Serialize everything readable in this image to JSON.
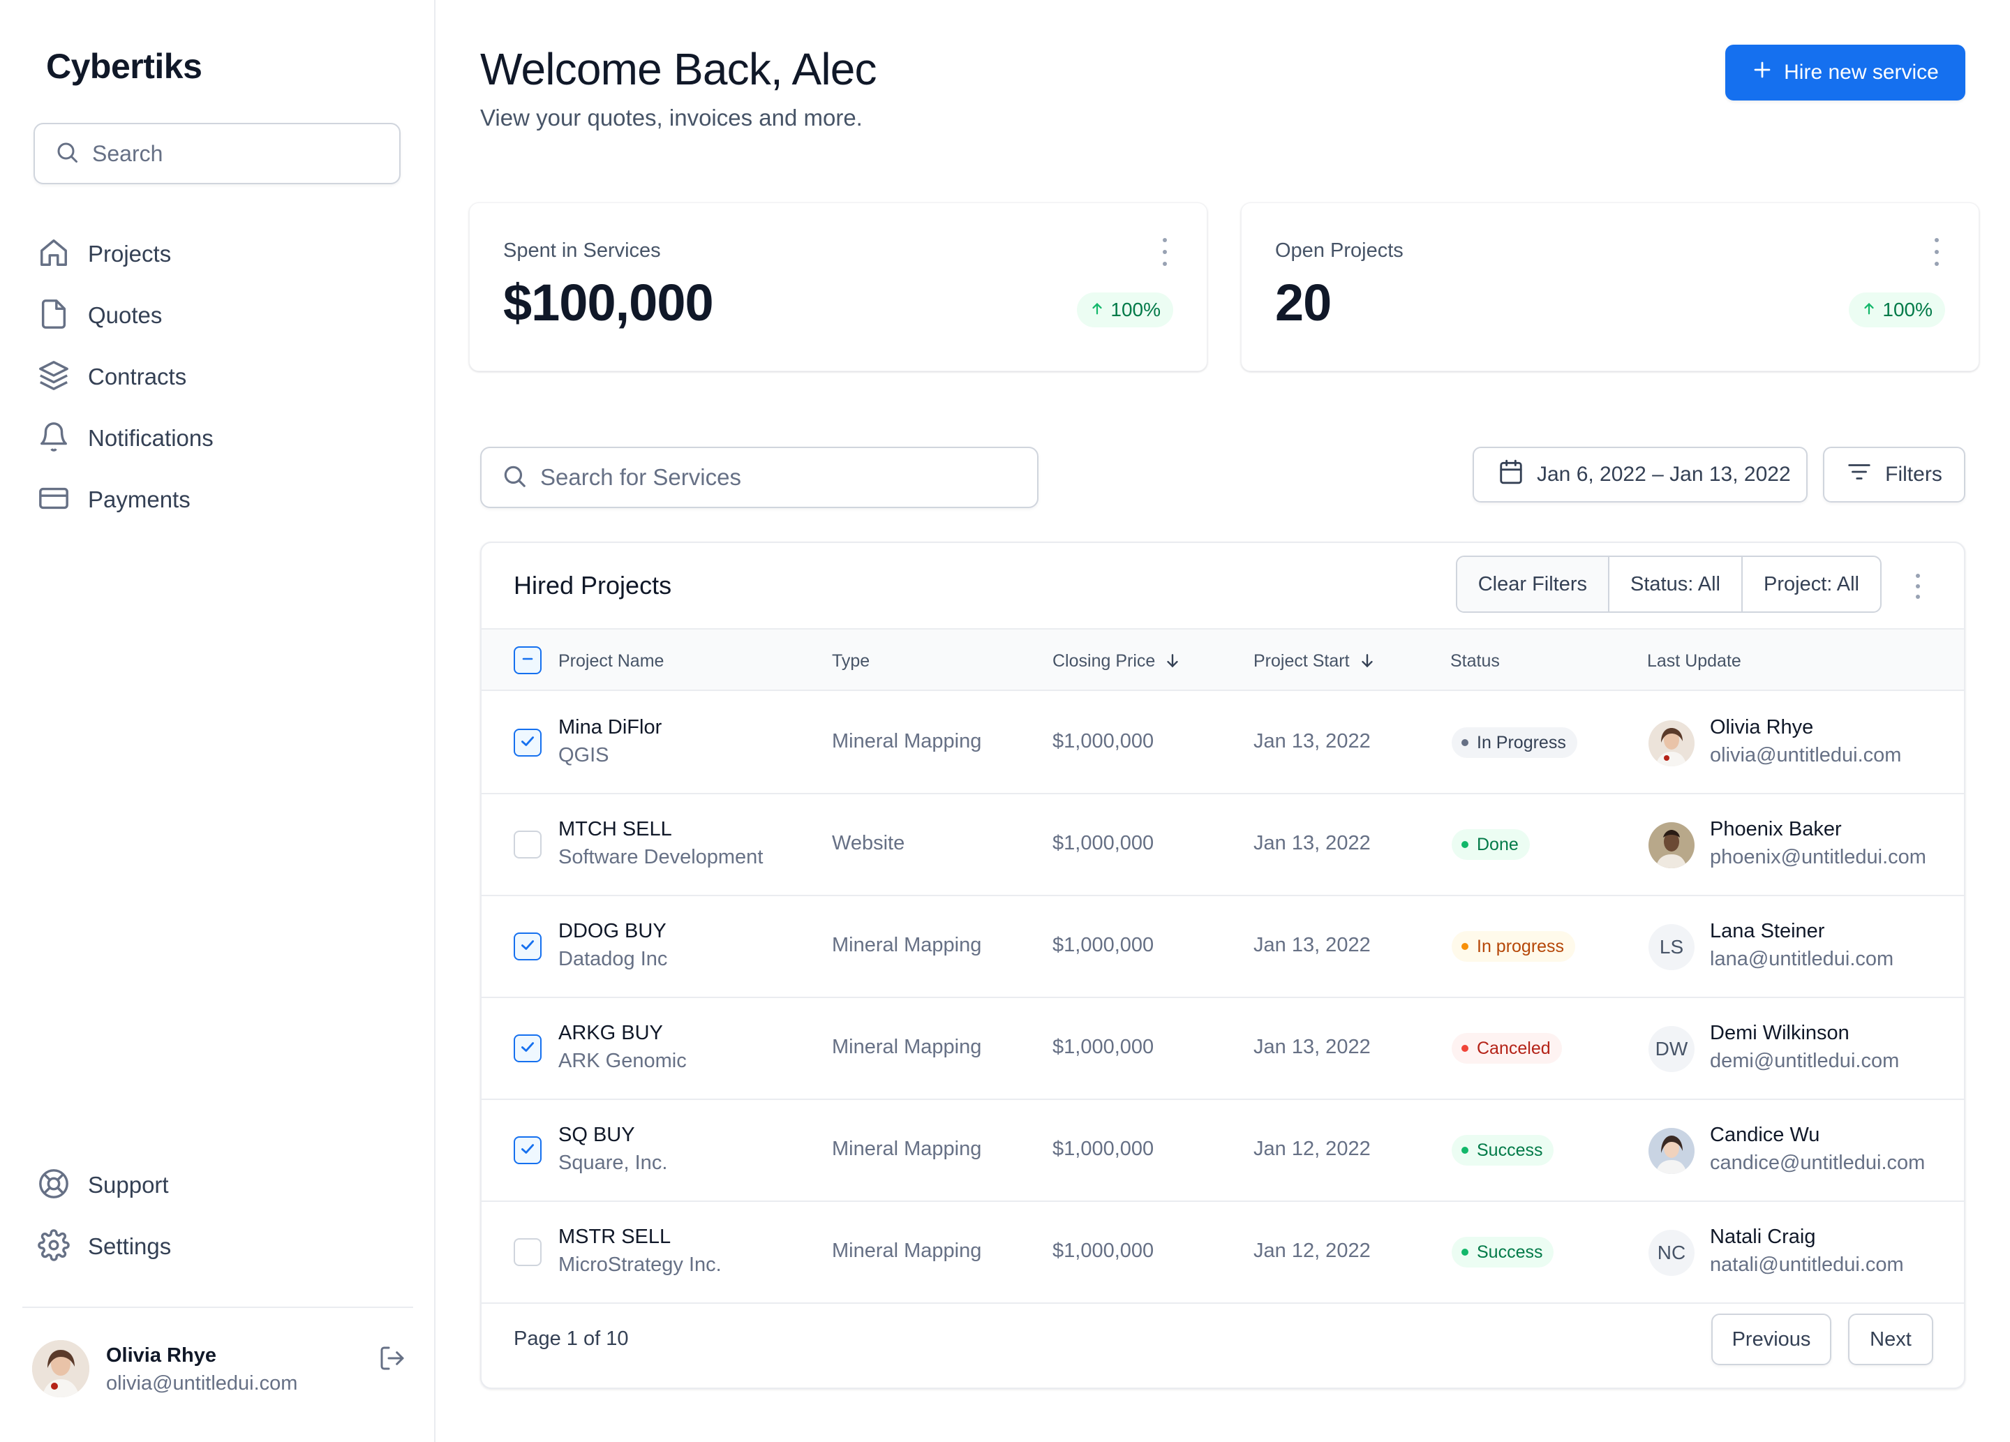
{
  "sidebar": {
    "brand": "Cybertiks",
    "search_placeholder": "Search",
    "nav": [
      {
        "label": "Projects",
        "icon": "home-icon"
      },
      {
        "label": "Quotes",
        "icon": "file-icon"
      },
      {
        "label": "Contracts",
        "icon": "layers-icon"
      },
      {
        "label": "Notifications",
        "icon": "bell-icon"
      },
      {
        "label": "Payments",
        "icon": "credit-card-icon"
      }
    ],
    "bottom_nav": [
      {
        "label": "Support",
        "icon": "life-buoy-icon"
      },
      {
        "label": "Settings",
        "icon": "gear-icon"
      }
    ],
    "user": {
      "name": "Olivia Rhye",
      "email": "olivia@untitledui.com"
    }
  },
  "header": {
    "title": "Welcome Back, Alec",
    "subtitle": "View your quotes, invoices and more.",
    "hire_button": "Hire new service"
  },
  "stats": [
    {
      "label": "Spent in Services",
      "value": "$100,000",
      "change": "100%"
    },
    {
      "label": "Open Projects",
      "value": "20",
      "change": "100%"
    }
  ],
  "toolbar": {
    "search_placeholder": "Search for Services",
    "date_range": "Jan 6, 2022 – Jan 13, 2022",
    "filters_label": "Filters"
  },
  "table": {
    "title": "Hired Projects",
    "segments": [
      "Clear Filters",
      "Status: All",
      "Project: All"
    ],
    "columns": [
      "Project Name",
      "Type",
      "Closing Price",
      "Project Start",
      "Status",
      "Last Update"
    ],
    "rows": [
      {
        "checked": true,
        "name": "Mina DiFlor",
        "company": "QGIS",
        "type": "Mineral Mapping",
        "price": "$1,000,000",
        "start": "Jan 13, 2022",
        "status": "In Progress",
        "status_kind": "gray",
        "user": "Olivia Rhye",
        "email": "olivia@untitledui.com",
        "initials": ""
      },
      {
        "checked": false,
        "name": "MTCH SELL",
        "company": "Software Development",
        "type": "Website",
        "price": "$1,000,000",
        "start": "Jan 13, 2022",
        "status": "Done",
        "status_kind": "green",
        "user": "Phoenix Baker",
        "email": "phoenix@untitledui.com",
        "initials": ""
      },
      {
        "checked": true,
        "name": "DDOG BUY",
        "company": "Datadog Inc",
        "type": "Mineral Mapping",
        "price": "$1,000,000",
        "start": "Jan 13, 2022",
        "status": "In progress",
        "status_kind": "amber",
        "user": "Lana Steiner",
        "email": "lana@untitledui.com",
        "initials": "LS"
      },
      {
        "checked": true,
        "name": "ARKG BUY",
        "company": "ARK Genomic",
        "type": "Mineral Mapping",
        "price": "$1,000,000",
        "start": "Jan 13, 2022",
        "status": "Canceled",
        "status_kind": "red",
        "user": "Demi Wilkinson",
        "email": "demi@untitledui.com",
        "initials": "DW"
      },
      {
        "checked": true,
        "name": "SQ BUY",
        "company": "Square, Inc.",
        "type": "Mineral Mapping",
        "price": "$1,000,000",
        "start": "Jan 12, 2022",
        "status": "Success",
        "status_kind": "green",
        "user": "Candice Wu",
        "email": "candice@untitledui.com",
        "initials": ""
      },
      {
        "checked": false,
        "name": "MSTR SELL",
        "company": "MicroStrategy Inc.",
        "type": "Mineral Mapping",
        "price": "$1,000,000",
        "start": "Jan 12, 2022",
        "status": "Success",
        "status_kind": "green",
        "user": "Natali Craig",
        "email": "natali@untitledui.com",
        "initials": "NC"
      }
    ],
    "pagination": {
      "info": "Page 1 of 10",
      "previous": "Previous",
      "next": "Next"
    }
  },
  "colors": {
    "accent": "#1570ef",
    "success_bg": "#ecfdf3",
    "success_text": "#027a48",
    "warning_bg": "#fffaeb",
    "warning_text": "#b54708",
    "error_bg": "#fef3f2",
    "error_text": "#b42318",
    "gray_bg": "#f2f4f7",
    "gray_text": "#344054"
  }
}
